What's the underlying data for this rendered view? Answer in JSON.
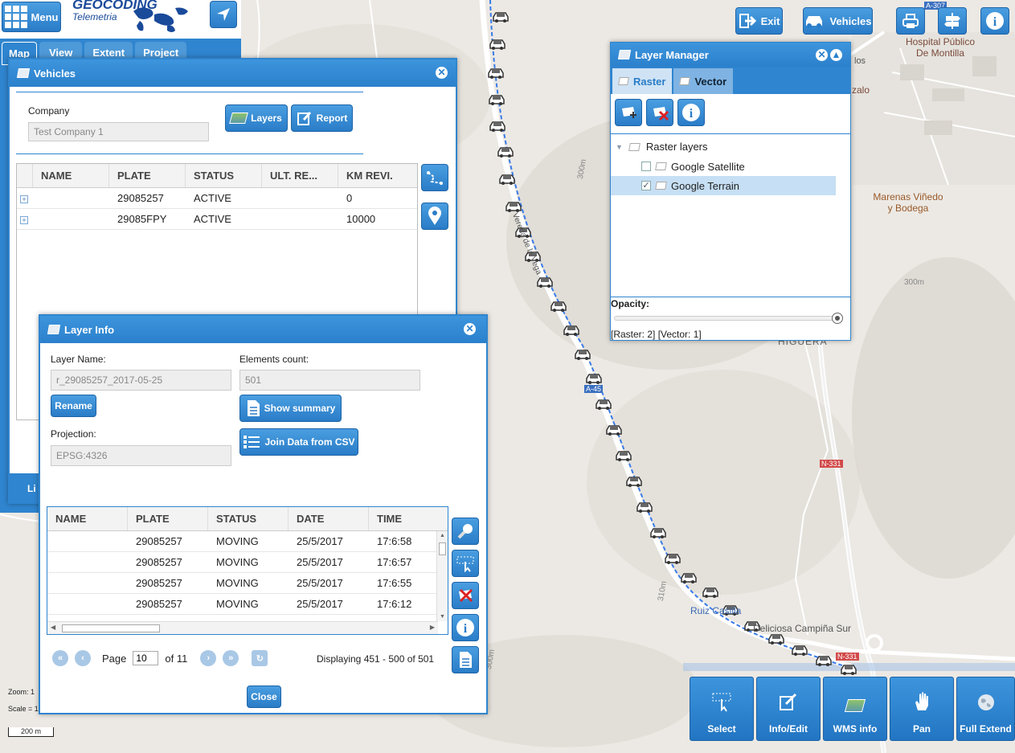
{
  "map": {
    "labels": {
      "hospital": "Hospital Público\nDe Montilla",
      "marenas": "Marenas Viñedo\ny Bodega",
      "higuera": "HIGUERA",
      "ruiz": "Ruiz Casilla",
      "campina": "Deliciosa Campiña Sur",
      "road_a45": "A-45",
      "road_n331a": "N-331",
      "road_n331b": "N-331",
      "alt_300a": "300m",
      "alt_300b": "300m",
      "alt_300c": "300m",
      "alt_310": "310m",
      "zalo": "zalo",
      "los": "los",
      "a307": "A-307",
      "vereda": "Vereda de la Vega"
    },
    "zoom_label": "Zoom: 1",
    "scale_label": "Scale = 1",
    "scale_bar": "200 m"
  },
  "header": {
    "menu_label": "Menu",
    "brand": "GEOCODING",
    "brand_sub": "Telemetria",
    "tabs": [
      "Map",
      "View",
      "Extent",
      "Project"
    ],
    "exit_label": "Exit",
    "vehicles_label": "Vehicles"
  },
  "vehicles_window": {
    "title": "Vehicles",
    "company_label": "Company",
    "company_value": "Test Company 1",
    "layers_btn": "Layers",
    "report_btn": "Report",
    "columns": [
      "NAME",
      "PLATE",
      "STATUS",
      "ULT. RE...",
      "KM REVI."
    ],
    "rows": [
      {
        "name": "",
        "plate": "29085257",
        "status": "ACTIVE",
        "ult": "",
        "km": "0"
      },
      {
        "name": "",
        "plate": "29085FPY",
        "status": "ACTIVE",
        "ult": "",
        "km": "10000"
      }
    ],
    "bottom_label": "Li"
  },
  "layer_info": {
    "title": "Layer Info",
    "layer_name_label": "Layer Name:",
    "layer_name_value": "r_29085257_2017-05-25",
    "elements_label": "Elements count:",
    "elements_value": "501",
    "rename_btn": "Rename",
    "show_summary_btn": "Show summary",
    "projection_label": "Projection:",
    "projection_value": "EPSG:4326",
    "join_btn": "Join Data from CSV",
    "columns": [
      "NAME",
      "PLATE",
      "STATUS",
      "DATE",
      "TIME"
    ],
    "rows": [
      {
        "name": "",
        "plate": "29085257",
        "status": "MOVING",
        "date": "25/5/2017",
        "time": "17:6:58"
      },
      {
        "name": "",
        "plate": "29085257",
        "status": "MOVING",
        "date": "25/5/2017",
        "time": "17:6:57"
      },
      {
        "name": "",
        "plate": "29085257",
        "status": "MOVING",
        "date": "25/5/2017",
        "time": "17:6:55"
      },
      {
        "name": "",
        "plate": "29085257",
        "status": "MOVING",
        "date": "25/5/2017",
        "time": "17:6:12"
      }
    ],
    "page_label": "Page",
    "page_value": "10",
    "page_of": "of 11",
    "displaying": "Displaying 451 - 500 of 501",
    "close_btn": "Close"
  },
  "layer_manager": {
    "title": "Layer Manager",
    "tab_raster": "Raster",
    "tab_vector": "Vector",
    "group_label": "Raster layers",
    "layers": [
      {
        "label": "Google Satellite",
        "checked": false
      },
      {
        "label": "Google Terrain",
        "checked": true
      }
    ],
    "opacity_label": "Opacity:",
    "opacity_value": 1.0,
    "counts": "[Raster: 2] [Vector: 1]"
  },
  "toolbar": {
    "select": "Select",
    "info_edit": "Info/Edit",
    "wms_info": "WMS info",
    "pan": "Pan",
    "full_extend": "Full Extend"
  },
  "colors": {
    "accent": "#2f85cf",
    "route": "#3a7be8",
    "map_bg": "#ece9e4"
  }
}
